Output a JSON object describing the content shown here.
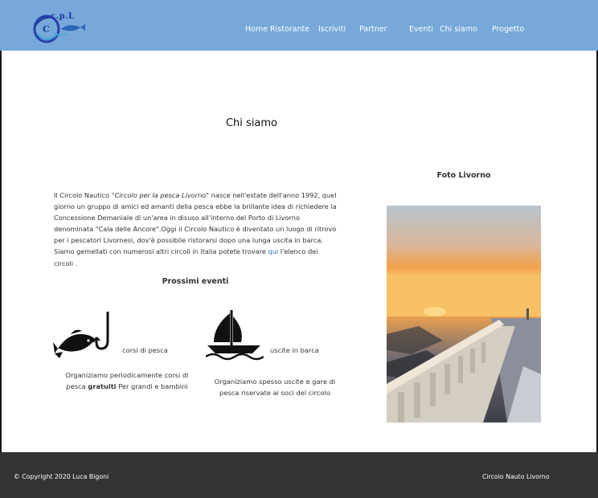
{
  "header": {
    "logo_text": "c.p.L",
    "logo_letter": "C",
    "nav": [
      {
        "label": "Home"
      },
      {
        "label": "Ristorante"
      },
      {
        "label": "Iscriviti"
      },
      {
        "label": "Partner"
      },
      {
        "label": "Eventi"
      },
      {
        "label": "Chi siamo"
      },
      {
        "label": "Progetto"
      }
    ]
  },
  "main": {
    "title": "Chi siamo",
    "intro": {
      "before_em": "Il Circolo Nautico ",
      "em": "\"Circolo per la pesca Livorno\"",
      "after_em": " nasce nell'estate dell'anno 1992, quel giorno un gruppo di amici ed amanti della pesca ebbe la brillante idea di richiedere la Concessione Demaniale di un'area in disuso all'interno del Porto di Livorno denominata \"Cala delle Ancore\".Oggi il Circolo Nautico è diventato un luogo di ritrovo per i pescatori Livornesi, dov'è possibile ristorarsi dopo una lunga uscita in barca. Siamo gemellati con numerosi altri circoli in italia potete trovare ",
      "link": "qui",
      "after_link": " l'elenco dei circoli ."
    },
    "events_heading": "Prossimi eventi",
    "events": [
      {
        "icon": "fish-hook-icon",
        "label": "corsi di pesca",
        "desc_before": "Organiziamo periodicamente corsi di pesca ",
        "desc_bold": "gratuiti",
        "desc_after": " Per grandi e bambini"
      },
      {
        "icon": "sailboat-icon",
        "label": "uscite in barca",
        "desc": "Organiziamo spesso uscite e gare di pesca riservate ai soci del circolo"
      }
    ],
    "photo": {
      "title": "Foto Livorno"
    }
  },
  "footer": {
    "copyright": "© Copyright 2020 Luca Bigoni",
    "brand": "Circolo Nauto Livorno"
  },
  "colors": {
    "header_bg": "#76a8d9",
    "footer_bg": "#333333",
    "link": "#2c6fb8"
  }
}
